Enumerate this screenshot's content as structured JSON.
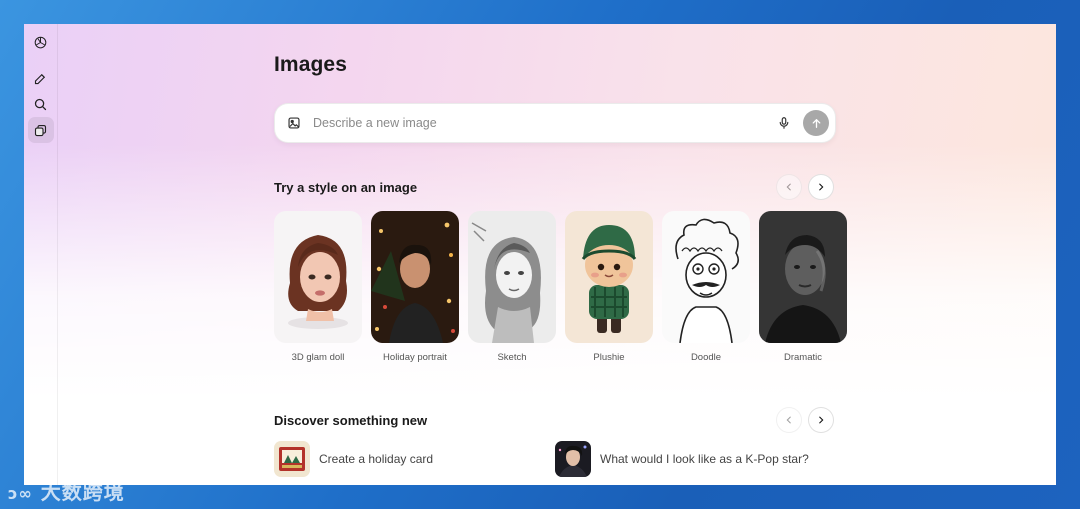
{
  "sidebar": {
    "items": [
      {
        "icon": "openai-logo-icon"
      },
      {
        "icon": "new-chat-icon"
      },
      {
        "icon": "search-icon"
      },
      {
        "icon": "images-icon",
        "active": true
      }
    ]
  },
  "page": {
    "title": "Images"
  },
  "composer": {
    "placeholder": "Describe a new image"
  },
  "styles_section": {
    "title": "Try a style on an image",
    "cards": [
      {
        "label": "3D glam doll"
      },
      {
        "label": "Holiday portrait"
      },
      {
        "label": "Sketch"
      },
      {
        "label": "Plushie"
      },
      {
        "label": "Doodle"
      },
      {
        "label": "Dramatic"
      }
    ]
  },
  "discover_section": {
    "title": "Discover something new",
    "items": [
      {
        "label": "Create a holiday card"
      },
      {
        "label": "What would I look like as a K-Pop star?"
      }
    ]
  },
  "watermark": {
    "text": "大数跨境"
  },
  "colors": {
    "send_button": "#a8a8a8",
    "text_primary": "#1a1a1a"
  }
}
